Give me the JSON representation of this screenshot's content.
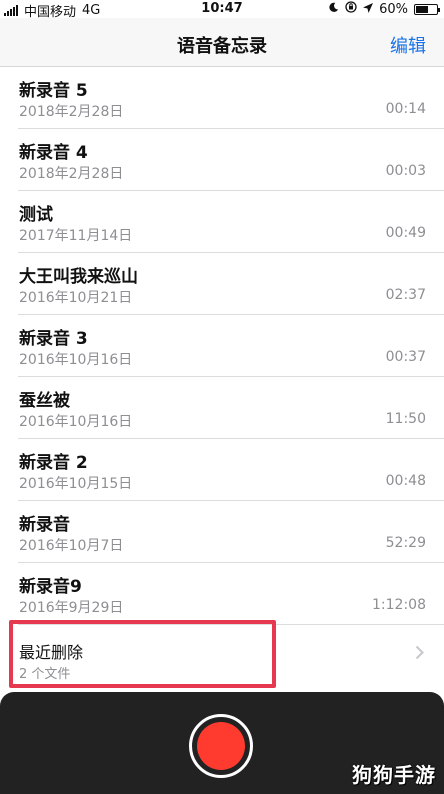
{
  "status_bar": {
    "carrier": "中国移动",
    "network": "4G",
    "time": "10:47",
    "battery_text": "60%",
    "battery_level": 0.6,
    "icons": [
      "signal-icon",
      "moon-icon",
      "lock-rotation-icon",
      "location-icon",
      "battery-icon"
    ]
  },
  "nav": {
    "title": "语音备忘录",
    "edit_label": "编辑",
    "accent_color": "#1a73e8"
  },
  "recordings": [
    {
      "name": "新录音 5",
      "date": "2018年2月28日",
      "duration": "00:14"
    },
    {
      "name": "新录音 4",
      "date": "2018年2月28日",
      "duration": "00:03"
    },
    {
      "name": "测试",
      "date": "2017年11月14日",
      "duration": "00:49"
    },
    {
      "name": "大王叫我来巡山",
      "date": "2016年10月21日",
      "duration": "02:37"
    },
    {
      "name": "新录音 3",
      "date": "2016年10月16日",
      "duration": "00:37"
    },
    {
      "name": "蚕丝被",
      "date": "2016年10月16日",
      "duration": "11:50"
    },
    {
      "name": "新录音 2",
      "date": "2016年10月15日",
      "duration": "00:48"
    },
    {
      "name": "新录音",
      "date": "2016年10月7日",
      "duration": "52:29"
    },
    {
      "name": "新录音9",
      "date": "2016年9月29日",
      "duration": "1:12:08"
    }
  ],
  "recently_deleted": {
    "label": "最近删除",
    "count_text": "2 个文件",
    "highlight_color": "#e63950"
  },
  "record_button": {
    "color": "#ff3b30",
    "icon": "record-icon"
  },
  "watermark": "狗狗手游"
}
